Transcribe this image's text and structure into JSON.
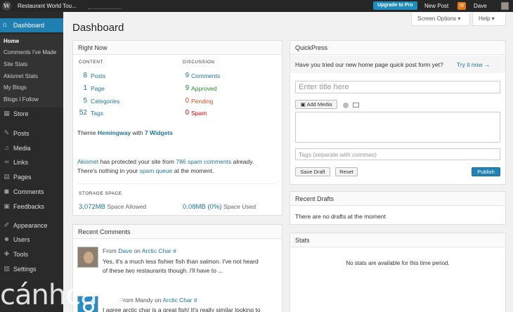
{
  "adminbar": {
    "logo": "W",
    "site_title": "Restaurant World Tou...",
    "upgrade": "Upgrade to Pro",
    "new_post": "New Post",
    "user": "Dave"
  },
  "sidebar": {
    "dashboard": "Dashboard",
    "sub": [
      "Home",
      "Comments I've Made",
      "Site Stats",
      "Akismet Stats",
      "My Blogs",
      "Blogs I Follow"
    ],
    "items": [
      "Store",
      "Posts",
      "Media",
      "Links",
      "Pages",
      "Comments",
      "Feedbacks",
      "Appearance",
      "Users",
      "Tools",
      "Settings"
    ]
  },
  "page": {
    "title": "Dashboard",
    "screen_options": "Screen Options ▾",
    "help": "Help ▾"
  },
  "right_now": {
    "title": "Right Now",
    "content_head": "CONTENT",
    "discussion_head": "DISCUSSION",
    "content": [
      {
        "num": "8",
        "label": "Posts"
      },
      {
        "num": "1",
        "label": "Page"
      },
      {
        "num": "5",
        "label": "Categories"
      },
      {
        "num": "52",
        "label": "Tags"
      }
    ],
    "discussion": [
      {
        "num": "9",
        "label": "Comments"
      },
      {
        "num": "9",
        "label": "Approved"
      },
      {
        "num": "0",
        "label": "Pending"
      },
      {
        "num": "0",
        "label": "Spam"
      }
    ],
    "theme_pre": "Theme",
    "theme_name": "Hemingway",
    "theme_mid": "with",
    "widgets": "7 Widgets",
    "ak_link": "Akismet",
    "ak_t1": "has protected your site from",
    "ak_spam": "786 spam comments",
    "ak_t2": "already.",
    "ak_t3": "There's nothing in your",
    "ak_queue": "spam queue",
    "ak_t4": "at the moment.",
    "storage_head": "STORAGE SPACE",
    "allowed_num": "3,072MB",
    "allowed_label": "Space Allowed",
    "used_num": "0.08MB (0%)",
    "used_label": "Space Used"
  },
  "recent_comments": {
    "title": "Recent Comments",
    "c1_from": "From",
    "c1_author": "Dave",
    "c1_on": "on",
    "c1_post": "Arctic Char #",
    "c1_l1": "Yes, it's a much less fishier fish than salmon. I've not heard",
    "c1_l2": "of these two restaurants though. I'll have to ...",
    "c2_from": "From Mandy on",
    "c2_post": "Arctic Char #",
    "c2_l1": "I agree arctic char is a great fish! It's really similar looking to"
  },
  "quickpress": {
    "title": "QuickPress",
    "notice": "Have you tried our new home page quick post form yet?",
    "try_it": "Try it now →",
    "title_placeholder": "Enter title here",
    "add_media": "Add Media",
    "tags_placeholder": "Tags (separate with commas)",
    "save_draft": "Save Draft",
    "reset": "Reset",
    "publish": "Publish"
  },
  "recent_drafts": {
    "title": "Recent Drafts",
    "empty": "There are no drafts at the moment"
  },
  "stats": {
    "title": "Stats",
    "empty": "No stats are available for this time period."
  },
  "watermark": "cánhcam"
}
